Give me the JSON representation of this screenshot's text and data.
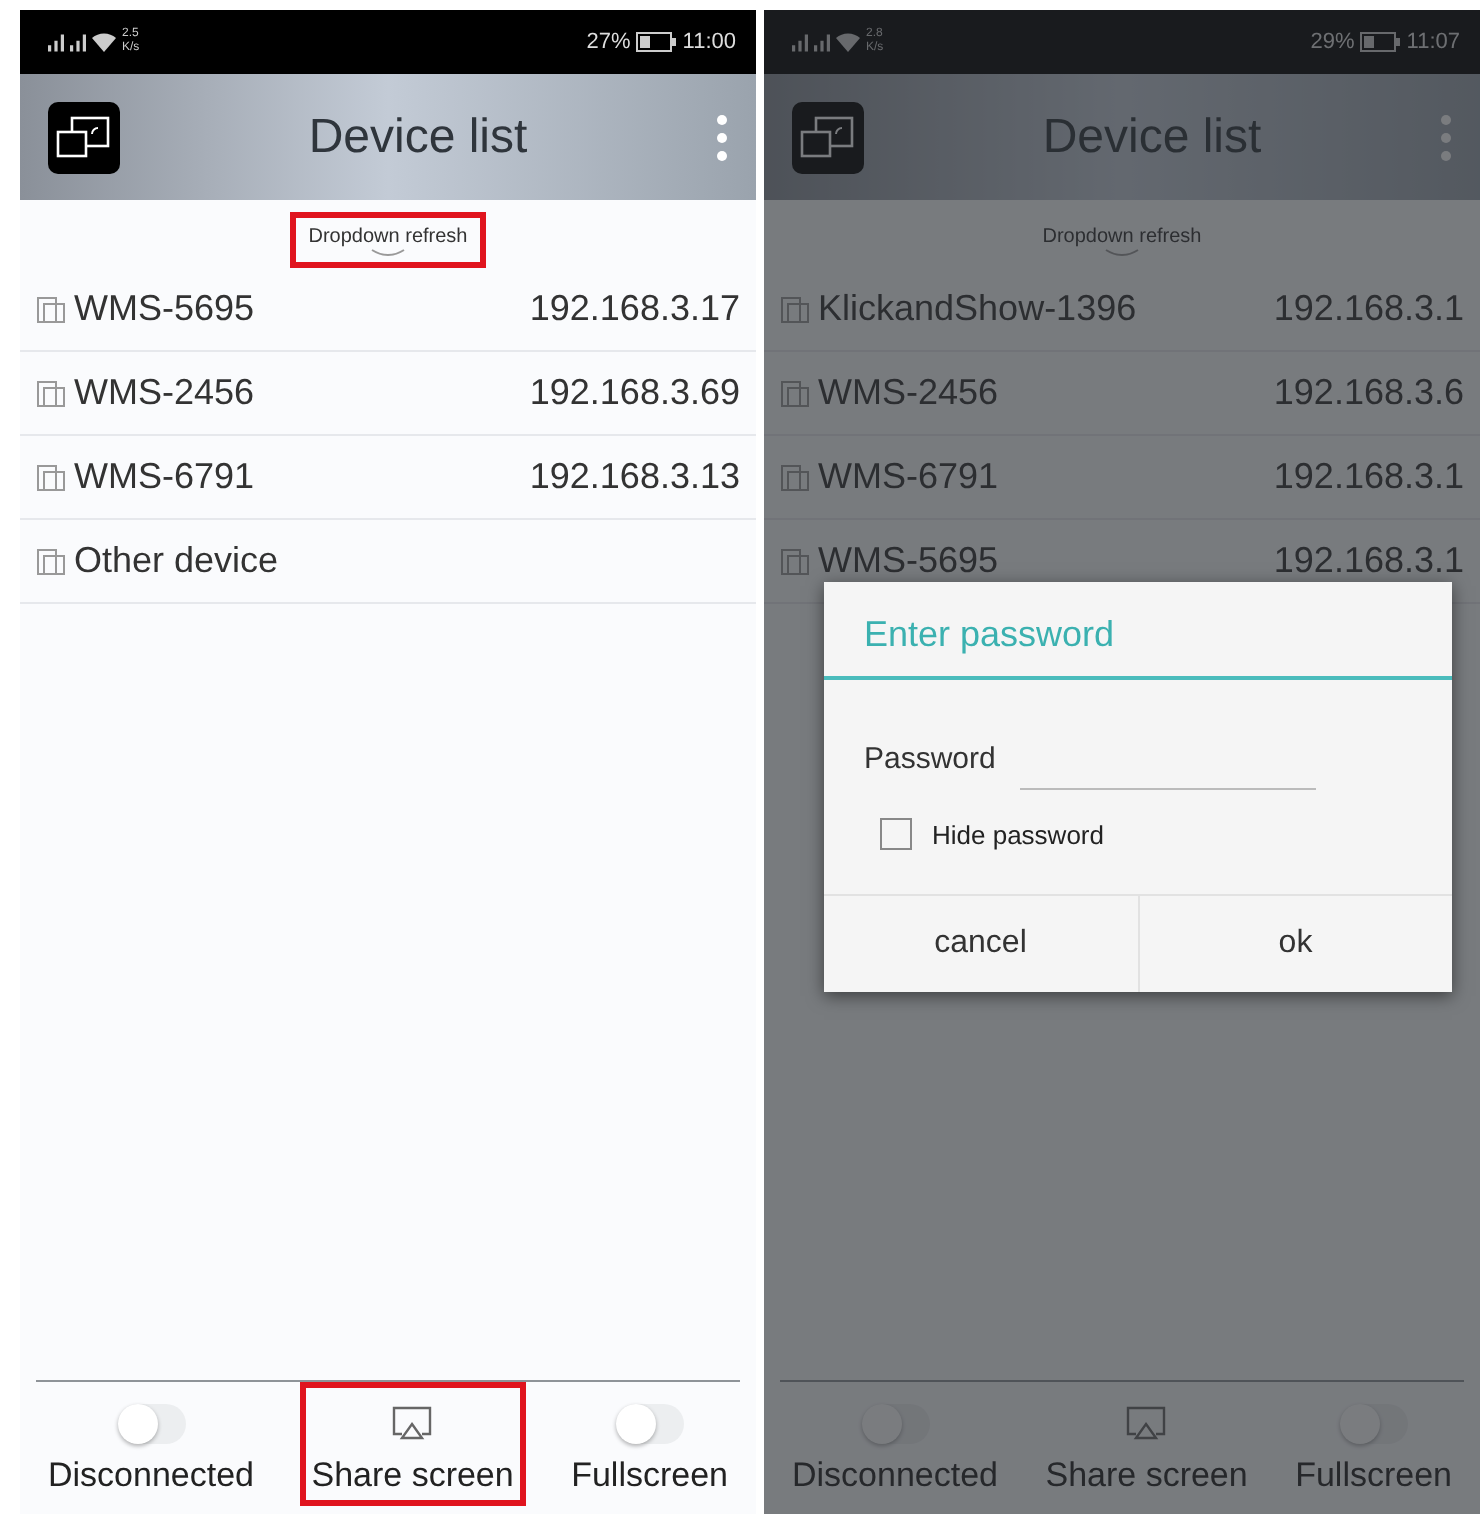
{
  "phones": [
    {
      "status_bar": {
        "speed": "2.5",
        "speed_unit": "K/s",
        "battery": "27%",
        "time": "11:00"
      },
      "title": "Device list",
      "dimmed": false,
      "refresh_hint": {
        "text": "Dropdown refresh",
        "highlighted": true
      },
      "devices": [
        {
          "name": "WMS-5695",
          "ip": "192.168.3.17"
        },
        {
          "name": "WMS-2456",
          "ip": "192.168.3.69"
        },
        {
          "name": "WMS-6791",
          "ip": "192.168.3.13"
        },
        {
          "name": "Other device"
        }
      ],
      "bottom": [
        {
          "kind": "toggle",
          "label": "Disconnected",
          "on": false,
          "highlighted": false
        },
        {
          "kind": "cast",
          "label": "Share screen",
          "highlighted": true
        },
        {
          "kind": "toggle",
          "label": "Fullscreen",
          "on": false,
          "highlighted": false
        }
      ]
    },
    {
      "status_bar": {
        "speed": "2.8",
        "speed_unit": "K/s",
        "battery": "29%",
        "time": "11:07"
      },
      "title": "Device list",
      "dimmed": true,
      "refresh_hint": {
        "text": "Dropdown refresh",
        "highlighted": false
      },
      "devices": [
        {
          "name": "KlickandShow-1396",
          "ip": "192.168.3.1"
        },
        {
          "name": "WMS-2456",
          "ip": "192.168.3.6"
        },
        {
          "name": "WMS-6791",
          "ip": "192.168.3.1"
        },
        {
          "name": "WMS-5695",
          "ip": "192.168.3.1"
        }
      ],
      "bottom": [
        {
          "kind": "toggle",
          "label": "Disconnected",
          "on": false,
          "highlighted": false
        },
        {
          "kind": "cast",
          "label": "Share screen",
          "highlighted": false
        },
        {
          "kind": "toggle",
          "label": "Fullscreen",
          "on": false,
          "highlighted": false
        }
      ],
      "dialog": {
        "title": "Enter password",
        "field_label": "Password",
        "checkbox": {
          "label": "Hide password",
          "checked": false
        },
        "buttons": [
          "cancel",
          "ok"
        ]
      }
    }
  ]
}
